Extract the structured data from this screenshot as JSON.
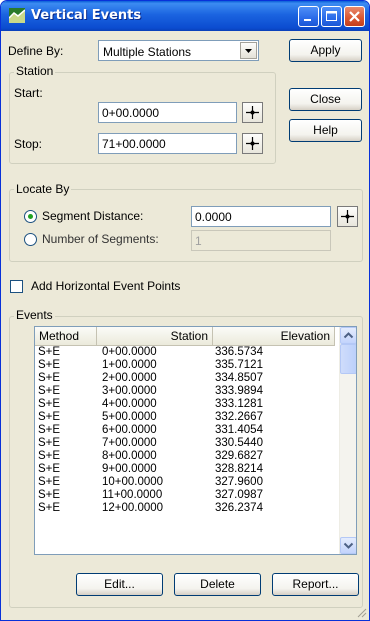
{
  "window": {
    "title": "Vertical Events"
  },
  "define_by": {
    "label": "Define By:",
    "value": "Multiple Stations"
  },
  "buttons": {
    "apply": "Apply",
    "close": "Close",
    "help": "Help",
    "edit": "Edit...",
    "delete": "Delete",
    "report": "Report..."
  },
  "station": {
    "group_label": "Station",
    "start_label": "Start:",
    "start_value": "0+00.0000",
    "stop_label": "Stop:",
    "stop_value": "71+00.0000"
  },
  "locate_by": {
    "group_label": "Locate By",
    "segment_distance_label": "Segment Distance:",
    "segment_distance_value": "0.0000",
    "segment_distance_selected": true,
    "number_of_segments_label": "Number of Segments:",
    "number_of_segments_value": "1",
    "number_of_segments_selected": false
  },
  "add_horizontal_event_points": {
    "label": "Add Horizontal Event Points",
    "checked": false
  },
  "events": {
    "group_label": "Events",
    "columns": [
      "Method",
      "Station",
      "Elevation"
    ],
    "rows": [
      [
        "S+E",
        "0+00.0000",
        "336.5734"
      ],
      [
        "S+E",
        "1+00.0000",
        "335.7121"
      ],
      [
        "S+E",
        "2+00.0000",
        "334.8507"
      ],
      [
        "S+E",
        "3+00.0000",
        "333.9894"
      ],
      [
        "S+E",
        "4+00.0000",
        "333.1281"
      ],
      [
        "S+E",
        "5+00.0000",
        "332.2667"
      ],
      [
        "S+E",
        "6+00.0000",
        "331.4054"
      ],
      [
        "S+E",
        "7+00.0000",
        "330.5440"
      ],
      [
        "S+E",
        "8+00.0000",
        "329.6827"
      ],
      [
        "S+E",
        "9+00.0000",
        "328.8214"
      ],
      [
        "S+E",
        "10+00.0000",
        "327.9600"
      ],
      [
        "S+E",
        "11+00.0000",
        "327.0987"
      ],
      [
        "S+E",
        "12+00.0000",
        "326.2374"
      ]
    ]
  },
  "icons": {
    "app": "road-profile-icon",
    "minimize": "minimize-icon",
    "maximize": "maximize-icon",
    "close": "close-icon",
    "pick": "crosshair-pick-icon",
    "dropdown": "chevron-down-icon",
    "scroll_up": "scroll-up-icon",
    "scroll_down": "scroll-down-icon"
  },
  "colors": {
    "titlebar": "#0b4cd0",
    "window_bg": "#ece9d8",
    "close_button": "#d9552f",
    "radio_dot": "#21a121"
  }
}
